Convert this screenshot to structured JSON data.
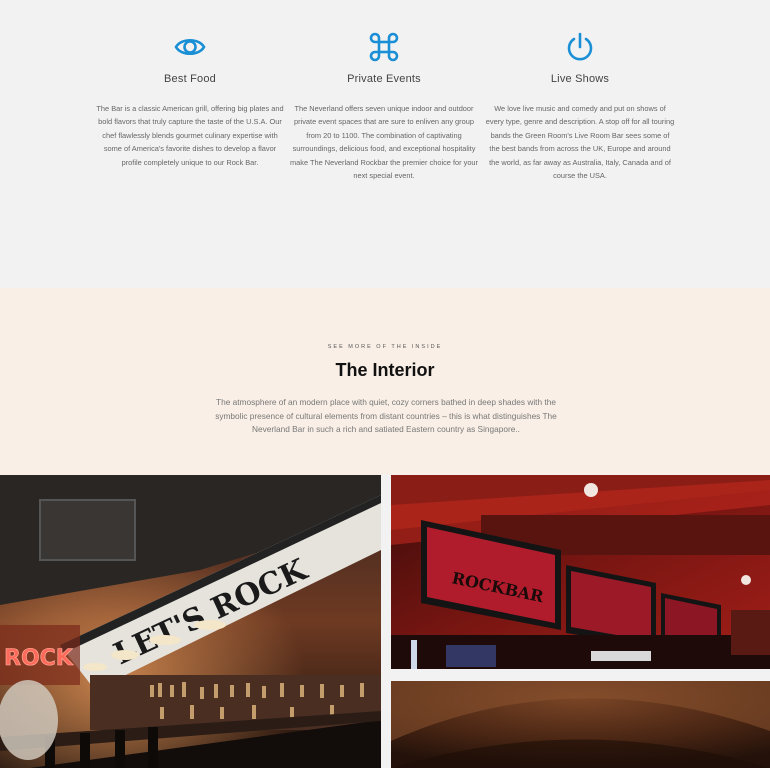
{
  "features": [
    {
      "icon": "eye-icon",
      "title": "Best Food",
      "description": "The Bar is a classic American grill, offering big plates and bold flavors that truly capture the taste of the U.S.A. Our chef flawlessly blends gourmet culinary expertise with some of America's favorite dishes to develop a flavor profile completely unique to our Rock Bar."
    },
    {
      "icon": "command-icon",
      "title": "Private Events",
      "description": "The Neverland offers seven unique indoor and outdoor private event spaces that are sure to enliven any group from 20 to 1100. The combination of captivating surroundings, delicious food, and exceptional hospitality make The Neverland Rockbar the premier choice for your next special event."
    },
    {
      "icon": "power-icon",
      "title": "Live Shows",
      "description": "We love live music and comedy and put on shows of every type, genre and description. A stop off for all touring bands the Green Room's Live Room Bar sees some of the best bands from across the UK, Europe and around the world, as far away as Australia, Italy, Canada and of course the USA."
    }
  ],
  "interior": {
    "kicker": "SEE MORE OF THE INSIDE",
    "title": "The Interior",
    "description": "The atmosphere of an modern place with quiet, cozy corners bathed in deep shades with the symbolic presence of cultural elements from distant countries – this is what distinguishes The Neverland Bar in such a rich and satiated Eastern country as Singapore.."
  },
  "photos": {
    "bar_sign_text": "LET'S ROCK",
    "neon_text": "ROCK",
    "screen_text": "ROCKBAR"
  },
  "colors": {
    "accent": "#1a8fd6",
    "features_bg": "#f2f2f2",
    "interior_bg": "#f9efe6"
  }
}
